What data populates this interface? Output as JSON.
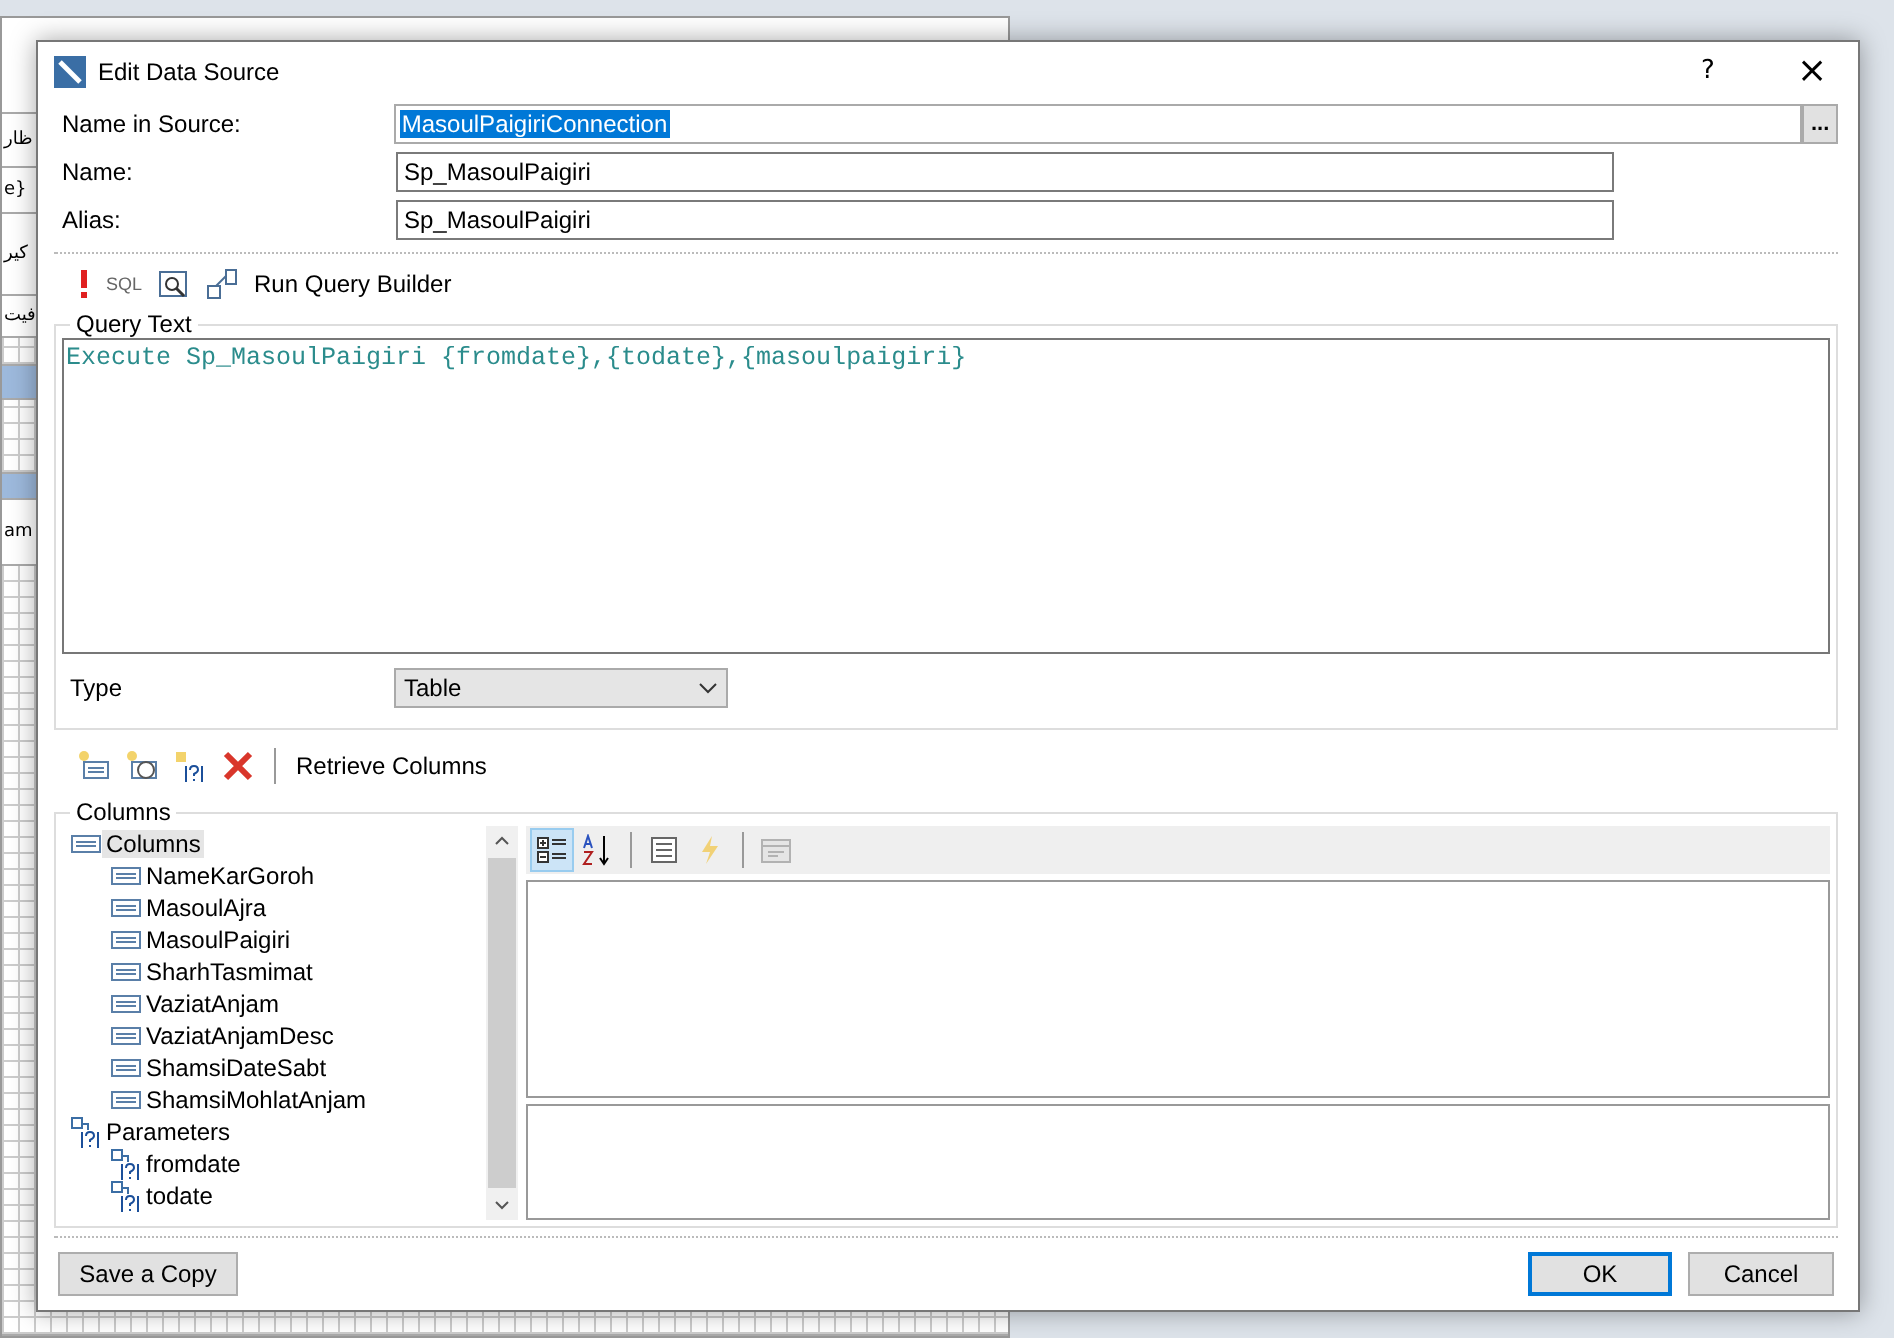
{
  "background_window": {
    "texts": [
      "ظار",
      "e}",
      "کیر",
      "فیت",
      "am"
    ]
  },
  "dialog": {
    "title": "Edit Data Source",
    "help": "?",
    "close": "×"
  },
  "fields": [
    {
      "label": "Name in Source:",
      "value": "MasoulPaigiriConnection",
      "highlighted": true,
      "browse": "..."
    },
    {
      "label": "Name:",
      "value": "Sp_MasoulPaigiri",
      "highlighted": false
    },
    {
      "label": "Alias:",
      "value": "Sp_MasoulPaigiri",
      "highlighted": false
    }
  ],
  "query_toolbar": {
    "sql": "SQL",
    "run_query_builder": "Run Query Builder"
  },
  "query_text": {
    "legend": "Query Text",
    "value": "Execute Sp_MasoulPaigiri {fromdate},{todate},{masoulpaigiri}"
  },
  "type": {
    "label": "Type",
    "value": "Table"
  },
  "columns_toolbar": {
    "retrieve": "Retrieve Columns"
  },
  "columns_group": {
    "legend": "Columns",
    "tree": [
      {
        "label": "Columns",
        "kind": "columns",
        "selected": true,
        "children": [
          {
            "label": "NameKarGoroh",
            "kind": "column",
            "selected": false
          },
          {
            "label": "MasoulAjra",
            "kind": "column",
            "selected": false
          },
          {
            "label": "MasoulPaigiri",
            "kind": "column",
            "selected": false
          },
          {
            "label": "SharhTasmimat",
            "kind": "column",
            "selected": false
          },
          {
            "label": "VaziatAnjam",
            "kind": "column",
            "selected": false
          },
          {
            "label": "VaziatAnjamDesc",
            "kind": "column",
            "selected": false
          },
          {
            "label": "ShamsiDateSabt",
            "kind": "column",
            "selected": false
          },
          {
            "label": "ShamsiMohlatAnjam",
            "kind": "column",
            "selected": false
          }
        ]
      },
      {
        "label": "Parameters",
        "kind": "parameters",
        "selected": false,
        "children": [
          {
            "label": "fromdate",
            "kind": "parameter",
            "selected": false
          },
          {
            "label": "todate",
            "kind": "parameter",
            "selected": false
          }
        ]
      }
    ]
  },
  "property_toolbar": [
    {
      "kind": "categorized",
      "selected": true,
      "disabled": false
    },
    {
      "kind": "alphabetical",
      "selected": false,
      "disabled": false
    },
    {
      "kind": "properties",
      "selected": false,
      "disabled": false
    },
    {
      "kind": "events",
      "selected": false,
      "disabled": true
    },
    {
      "kind": "property_pages",
      "selected": false,
      "disabled": true
    }
  ],
  "buttons": [
    {
      "kind": "save_copy",
      "label": "Save a Copy",
      "default": false
    },
    {
      "kind": "ok",
      "label": "OK",
      "default": true
    },
    {
      "kind": "cancel",
      "label": "Cancel",
      "default": false
    }
  ]
}
